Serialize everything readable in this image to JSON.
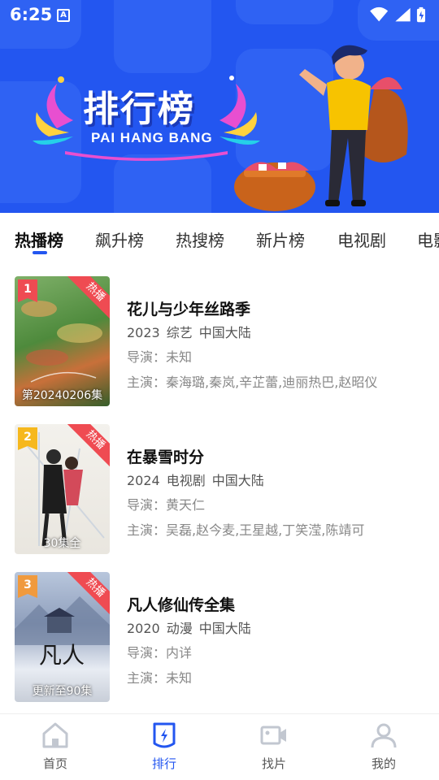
{
  "status_bar": {
    "time": "6:25",
    "notification_letter": "A"
  },
  "banner": {
    "title": "排行榜",
    "subtitle": "PAI HANG BANG"
  },
  "tabs": [
    {
      "label": "热播榜",
      "active": true
    },
    {
      "label": "飙升榜"
    },
    {
      "label": "热搜榜"
    },
    {
      "label": "新片榜"
    },
    {
      "label": "电视剧"
    },
    {
      "label": "电影"
    }
  ],
  "hot_tag": "热播",
  "items": [
    {
      "rank": "1",
      "rank_color": "#ef4b52",
      "poster_caption": "第20240206集",
      "title": "花儿与少年丝路季",
      "year": "2023",
      "genre": "综艺",
      "region": "中国大陆",
      "director": "导演：未知",
      "cast": "主演：秦海璐,秦岚,辛芷蕾,迪丽热巴,赵昭仪"
    },
    {
      "rank": "2",
      "rank_color": "#f6b81d",
      "poster_caption": "30集全",
      "title": "在暴雪时分",
      "year": "2024",
      "genre": "电视剧",
      "region": "中国大陆",
      "director": "导演：黄天仁",
      "cast": "主演：吴磊,赵今麦,王星越,丁笑滢,陈靖可"
    },
    {
      "rank": "3",
      "rank_color": "#f09a3e",
      "poster_caption": "更新至90集",
      "title": "凡人修仙传全集",
      "year": "2020",
      "genre": "动漫",
      "region": "中国大陆",
      "director": "导演：内详",
      "cast": "主演：未知"
    }
  ],
  "bottom_nav": [
    {
      "label": "首页",
      "icon": "home-icon"
    },
    {
      "label": "排行",
      "icon": "ranking-icon",
      "active": true
    },
    {
      "label": "找片",
      "icon": "video-camera-icon"
    },
    {
      "label": "我的",
      "icon": "user-icon"
    }
  ],
  "colors": {
    "accent": "#2356f0",
    "hot": "#ef4b52"
  }
}
